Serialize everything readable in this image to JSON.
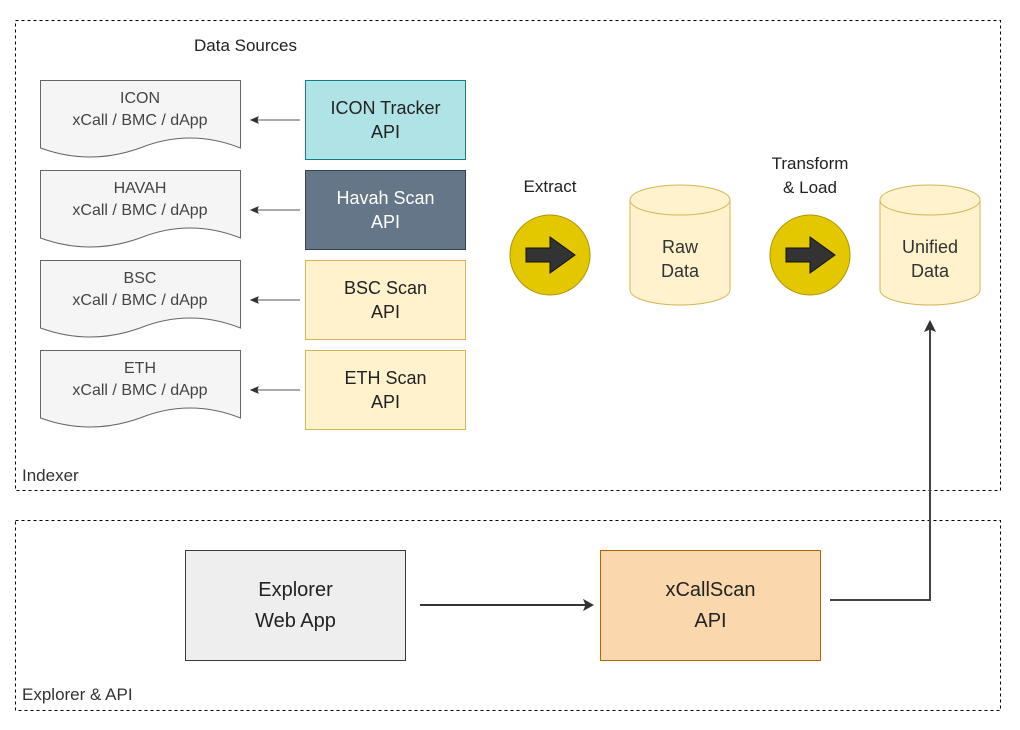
{
  "groups": {
    "indexer": {
      "label": "Indexer"
    },
    "explorer": {
      "label": "Explorer & API"
    }
  },
  "data_sources": {
    "title": "Data Sources",
    "documents": [
      {
        "chain": "ICON",
        "subtitle": "xCall / BMC / dApp"
      },
      {
        "chain": "HAVAH",
        "subtitle": "xCall / BMC / dApp"
      },
      {
        "chain": "BSC",
        "subtitle": "xCall / BMC / dApp"
      },
      {
        "chain": "ETH",
        "subtitle": "xCall / BMC / dApp"
      }
    ],
    "apis": [
      {
        "line1": "ICON Tracker",
        "line2": "API",
        "fill": "#b0e3e6",
        "stroke": "#0e8088",
        "text": "#222222"
      },
      {
        "line1": "Havah Scan",
        "line2": "API",
        "fill": "#647687",
        "stroke": "#314354",
        "text": "#ffffff"
      },
      {
        "line1": "BSC Scan",
        "line2": "API",
        "fill": "#fff2cc",
        "stroke": "#d6b656",
        "text": "#222222"
      },
      {
        "line1": "ETH Scan",
        "line2": "API",
        "fill": "#fff2cc",
        "stroke": "#d6b656",
        "text": "#222222"
      }
    ]
  },
  "pipeline": {
    "extract_label": "Extract",
    "transform_label_1": "Transform",
    "transform_label_2": "& Load",
    "raw_data": {
      "line1": "Raw",
      "line2": "Data"
    },
    "unified_data": {
      "line1": "Unified",
      "line2": "Data"
    },
    "icons": {
      "extract": "arrow-right-icon",
      "transform": "arrow-right-icon"
    }
  },
  "explorer_section": {
    "web_app": {
      "line1": "Explorer",
      "line2": "Web App"
    },
    "api": {
      "line1": "xCallScan",
      "line2": "API"
    }
  },
  "colors": {
    "step_circle": "#e3c800",
    "step_circle_stroke": "#b09500",
    "cylinder_fill": "#fff2cc",
    "cylinder_stroke": "#d6b656",
    "web_app_fill": "#eeeeee",
    "web_app_stroke": "#36393d",
    "xcallscan_fill": "#fad7ac",
    "xcallscan_stroke": "#b46504",
    "document_fill": "#f5f5f5",
    "document_stroke": "#666666"
  }
}
